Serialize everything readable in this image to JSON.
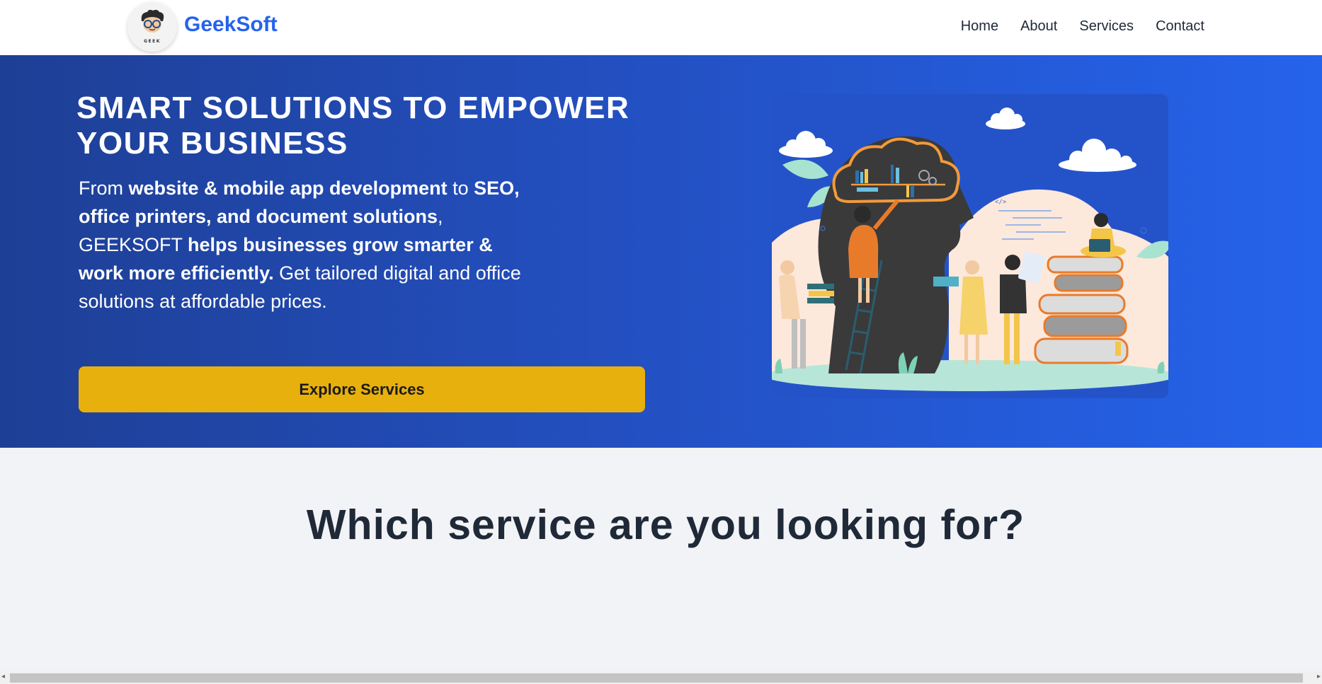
{
  "header": {
    "brand": "GeekSoft",
    "logo_text": "GEEK",
    "nav": [
      "Home",
      "About",
      "Services",
      "Contact"
    ]
  },
  "hero": {
    "title": "SMART SOLUTIONS TO EMPOWER YOUR BUSINESS",
    "text_parts": [
      {
        "text": "From ",
        "bold": false
      },
      {
        "text": "website & mobile app development",
        "bold": true
      },
      {
        "text": " to ",
        "bold": false
      },
      {
        "text": "SEO, office printers, and document solutions",
        "bold": true
      },
      {
        "text": ", GEEKSOFT ",
        "bold": false
      },
      {
        "text": "helps businesses grow smarter & work more efficiently.",
        "bold": true
      },
      {
        "text": " Get tailored digital and office solutions at affordable prices.",
        "bold": false
      }
    ],
    "cta_label": "Explore Services",
    "illustration_code": "</>"
  },
  "section": {
    "title": "Which service are you looking for?"
  },
  "colors": {
    "brand": "#2563eb",
    "cta": "#e8b00c",
    "hero_start": "#1e3f95",
    "hero_end": "#2563eb"
  }
}
